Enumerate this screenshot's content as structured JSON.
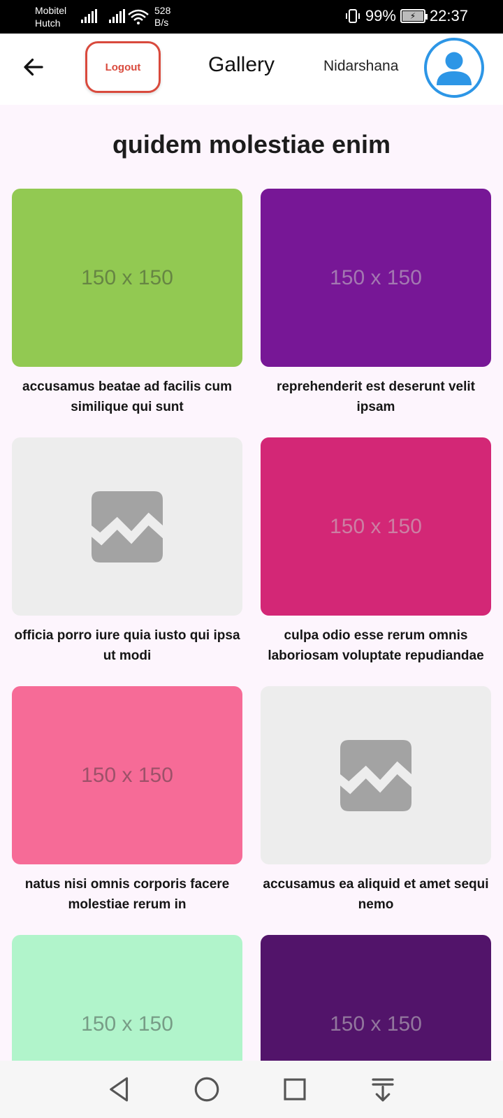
{
  "status_bar": {
    "carrier_1": "Mobitel",
    "carrier_2": "Hutch",
    "net_speed_value": "528",
    "net_speed_unit": "B/s",
    "battery_percent": "99%",
    "time": "22:37"
  },
  "app_bar": {
    "logout_label": "Logout",
    "title": "Gallery",
    "username": "Nidarshana"
  },
  "album": {
    "title": "quidem molestiae enim"
  },
  "photos": [
    {
      "caption": "accusamus beatae ad facilis cum similique qui sunt",
      "placeholder": "150 x 150",
      "color": "#92c952"
    },
    {
      "caption": "reprehenderit est deserunt velit ipsam",
      "placeholder": "150 x 150",
      "color": "#771796"
    },
    {
      "caption": "officia porro iure quia iusto qui ipsa ut modi",
      "placeholder": "",
      "color": "#ededed"
    },
    {
      "caption": "culpa odio esse rerum omnis laboriosam voluptate repudiandae",
      "placeholder": "150 x 150",
      "color": "#d32776"
    },
    {
      "caption": "natus nisi omnis corporis facere molestiae rerum in",
      "placeholder": "150 x 150",
      "color": "#f66b97"
    },
    {
      "caption": "accusamus ea aliquid et amet sequi nemo",
      "placeholder": "",
      "color": "#ededed"
    },
    {
      "caption": "",
      "placeholder": "150 x 150",
      "color": "#b1f4cb"
    },
    {
      "caption": "",
      "placeholder": "150 x 150",
      "color": "#52146a"
    }
  ],
  "icons": {
    "back": "arrow-left-icon",
    "avatar": "person-icon",
    "broken_image": "broken-image-icon",
    "nav_back": "triangle-back-icon",
    "nav_home": "circle-home-icon",
    "nav_recents": "square-recents-icon",
    "nav_notifications": "pull-down-icon"
  }
}
